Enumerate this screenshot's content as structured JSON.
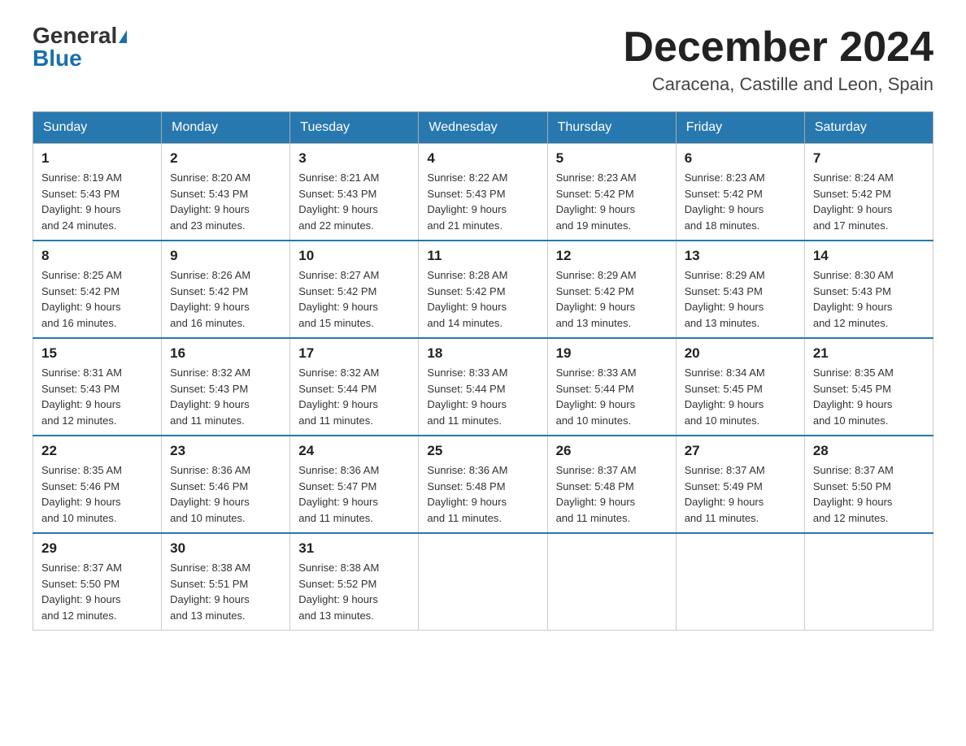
{
  "header": {
    "logo_general": "General",
    "logo_blue": "Blue",
    "month_title": "December 2024",
    "location": "Caracena, Castille and Leon, Spain"
  },
  "days_of_week": [
    "Sunday",
    "Monday",
    "Tuesday",
    "Wednesday",
    "Thursday",
    "Friday",
    "Saturday"
  ],
  "weeks": [
    [
      {
        "day": "1",
        "sunrise": "8:19 AM",
        "sunset": "5:43 PM",
        "daylight": "9 hours and 24 minutes."
      },
      {
        "day": "2",
        "sunrise": "8:20 AM",
        "sunset": "5:43 PM",
        "daylight": "9 hours and 23 minutes."
      },
      {
        "day": "3",
        "sunrise": "8:21 AM",
        "sunset": "5:43 PM",
        "daylight": "9 hours and 22 minutes."
      },
      {
        "day": "4",
        "sunrise": "8:22 AM",
        "sunset": "5:43 PM",
        "daylight": "9 hours and 21 minutes."
      },
      {
        "day": "5",
        "sunrise": "8:23 AM",
        "sunset": "5:42 PM",
        "daylight": "9 hours and 19 minutes."
      },
      {
        "day": "6",
        "sunrise": "8:23 AM",
        "sunset": "5:42 PM",
        "daylight": "9 hours and 18 minutes."
      },
      {
        "day": "7",
        "sunrise": "8:24 AM",
        "sunset": "5:42 PM",
        "daylight": "9 hours and 17 minutes."
      }
    ],
    [
      {
        "day": "8",
        "sunrise": "8:25 AM",
        "sunset": "5:42 PM",
        "daylight": "9 hours and 16 minutes."
      },
      {
        "day": "9",
        "sunrise": "8:26 AM",
        "sunset": "5:42 PM",
        "daylight": "9 hours and 16 minutes."
      },
      {
        "day": "10",
        "sunrise": "8:27 AM",
        "sunset": "5:42 PM",
        "daylight": "9 hours and 15 minutes."
      },
      {
        "day": "11",
        "sunrise": "8:28 AM",
        "sunset": "5:42 PM",
        "daylight": "9 hours and 14 minutes."
      },
      {
        "day": "12",
        "sunrise": "8:29 AM",
        "sunset": "5:42 PM",
        "daylight": "9 hours and 13 minutes."
      },
      {
        "day": "13",
        "sunrise": "8:29 AM",
        "sunset": "5:43 PM",
        "daylight": "9 hours and 13 minutes."
      },
      {
        "day": "14",
        "sunrise": "8:30 AM",
        "sunset": "5:43 PM",
        "daylight": "9 hours and 12 minutes."
      }
    ],
    [
      {
        "day": "15",
        "sunrise": "8:31 AM",
        "sunset": "5:43 PM",
        "daylight": "9 hours and 12 minutes."
      },
      {
        "day": "16",
        "sunrise": "8:32 AM",
        "sunset": "5:43 PM",
        "daylight": "9 hours and 11 minutes."
      },
      {
        "day": "17",
        "sunrise": "8:32 AM",
        "sunset": "5:44 PM",
        "daylight": "9 hours and 11 minutes."
      },
      {
        "day": "18",
        "sunrise": "8:33 AM",
        "sunset": "5:44 PM",
        "daylight": "9 hours and 11 minutes."
      },
      {
        "day": "19",
        "sunrise": "8:33 AM",
        "sunset": "5:44 PM",
        "daylight": "9 hours and 10 minutes."
      },
      {
        "day": "20",
        "sunrise": "8:34 AM",
        "sunset": "5:45 PM",
        "daylight": "9 hours and 10 minutes."
      },
      {
        "day": "21",
        "sunrise": "8:35 AM",
        "sunset": "5:45 PM",
        "daylight": "9 hours and 10 minutes."
      }
    ],
    [
      {
        "day": "22",
        "sunrise": "8:35 AM",
        "sunset": "5:46 PM",
        "daylight": "9 hours and 10 minutes."
      },
      {
        "day": "23",
        "sunrise": "8:36 AM",
        "sunset": "5:46 PM",
        "daylight": "9 hours and 10 minutes."
      },
      {
        "day": "24",
        "sunrise": "8:36 AM",
        "sunset": "5:47 PM",
        "daylight": "9 hours and 11 minutes."
      },
      {
        "day": "25",
        "sunrise": "8:36 AM",
        "sunset": "5:48 PM",
        "daylight": "9 hours and 11 minutes."
      },
      {
        "day": "26",
        "sunrise": "8:37 AM",
        "sunset": "5:48 PM",
        "daylight": "9 hours and 11 minutes."
      },
      {
        "day": "27",
        "sunrise": "8:37 AM",
        "sunset": "5:49 PM",
        "daylight": "9 hours and 11 minutes."
      },
      {
        "day": "28",
        "sunrise": "8:37 AM",
        "sunset": "5:50 PM",
        "daylight": "9 hours and 12 minutes."
      }
    ],
    [
      {
        "day": "29",
        "sunrise": "8:37 AM",
        "sunset": "5:50 PM",
        "daylight": "9 hours and 12 minutes."
      },
      {
        "day": "30",
        "sunrise": "8:38 AM",
        "sunset": "5:51 PM",
        "daylight": "9 hours and 13 minutes."
      },
      {
        "day": "31",
        "sunrise": "8:38 AM",
        "sunset": "5:52 PM",
        "daylight": "9 hours and 13 minutes."
      },
      null,
      null,
      null,
      null
    ]
  ],
  "labels": {
    "sunrise": "Sunrise:",
    "sunset": "Sunset:",
    "daylight": "Daylight:"
  }
}
